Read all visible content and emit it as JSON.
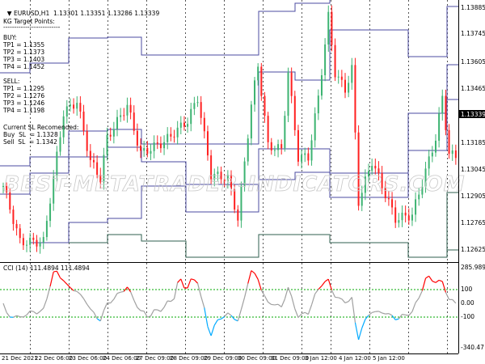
{
  "header": {
    "symbol": "EURUSD,H1",
    "ohlc": "1.13301 1.13351 1.13286 1.13339"
  },
  "panel": {
    "title": "KG Target Points:",
    "divider": "--------------------------",
    "buy_label": "BUY:",
    "buy": [
      "TP1 = 1.1355",
      "TP2 = 1.1373",
      "TP3 = 1.1403",
      "TP4 = 1.1452"
    ],
    "sell_label": "SELL:",
    "sell": [
      "TP1 = 1.1295",
      "TP2 = 1.1276",
      "TP3 = 1.1246",
      "TP4 = 1.1198"
    ],
    "sl_label": "Current SL Recomended:",
    "buy_sl": "Buy  SL  = 1.1328",
    "sell_sl": "Sell  SL  = 1.1342"
  },
  "watermark": "BEST-METATRADER-INDICATORS.COM",
  "price_axis": [
    "1.13885",
    "1.13745",
    "1.13605",
    "1.13465",
    "1.13185",
    "1.13045",
    "1.12905",
    "1.12765",
    "1.12625"
  ],
  "current_price": "1.13339",
  "osc": {
    "title": "CCI (14) 111.4894 111.4894",
    "axis": [
      "285.989",
      "100",
      "0.00",
      "-100",
      "-340.47"
    ]
  },
  "time_axis": [
    "21 Dec 2021",
    "22 Dec 06:00",
    "23 Dec 06:00",
    "24 Dec 06:00",
    "27 Dec 09:00",
    "28 Dec 09:00",
    "29 Dec 09:00",
    "30 Dec 09:00",
    "31 Dec 09:00",
    "3 Jan 12:00",
    "4 Jan 12:00",
    "5 Jan 12:00"
  ],
  "colors": {
    "bull": "#3cb371",
    "bear": "#ff2020",
    "cci_up": "#ff0000",
    "cci_down": "#00aaff",
    "cci_mid": "#a0a0a0",
    "level": "#00aa00",
    "target": "#4b4ba0"
  },
  "chart_data": {
    "type": "candlestick",
    "ylim": [
      1.1258,
      1.1395
    ],
    "keypoints": [
      [
        0,
        1.1296
      ],
      [
        5,
        1.1267
      ],
      [
        12,
        1.1267
      ],
      [
        18,
        1.1334
      ],
      [
        22,
        1.134
      ],
      [
        26,
        1.1309
      ],
      [
        29,
        1.13
      ],
      [
        31,
        1.1321
      ],
      [
        37,
        1.1338
      ],
      [
        41,
        1.1313
      ],
      [
        48,
        1.1319
      ],
      [
        55,
        1.133
      ],
      [
        58,
        1.1342
      ],
      [
        62,
        1.1302
      ],
      [
        67,
        1.13
      ],
      [
        70,
        1.1279
      ],
      [
        74,
        1.1338
      ],
      [
        76,
        1.1359
      ],
      [
        79,
        1.1317
      ],
      [
        83,
        1.1315
      ],
      [
        85,
        1.1355
      ],
      [
        88,
        1.1311
      ],
      [
        91,
        1.1311
      ],
      [
        94,
        1.1342
      ],
      [
        97,
        1.1384
      ],
      [
        99,
        1.1355
      ],
      [
        102,
        1.1346
      ],
      [
        104,
        1.1357
      ],
      [
        106,
        1.1288
      ],
      [
        110,
        1.1309
      ],
      [
        113,
        1.1296
      ],
      [
        117,
        1.1279
      ],
      [
        122,
        1.1281
      ],
      [
        125,
        1.1298
      ],
      [
        129,
        1.1321
      ],
      [
        131,
        1.1342
      ],
      [
        133,
        1.1313
      ],
      [
        135,
        1.1311
      ]
    ]
  }
}
